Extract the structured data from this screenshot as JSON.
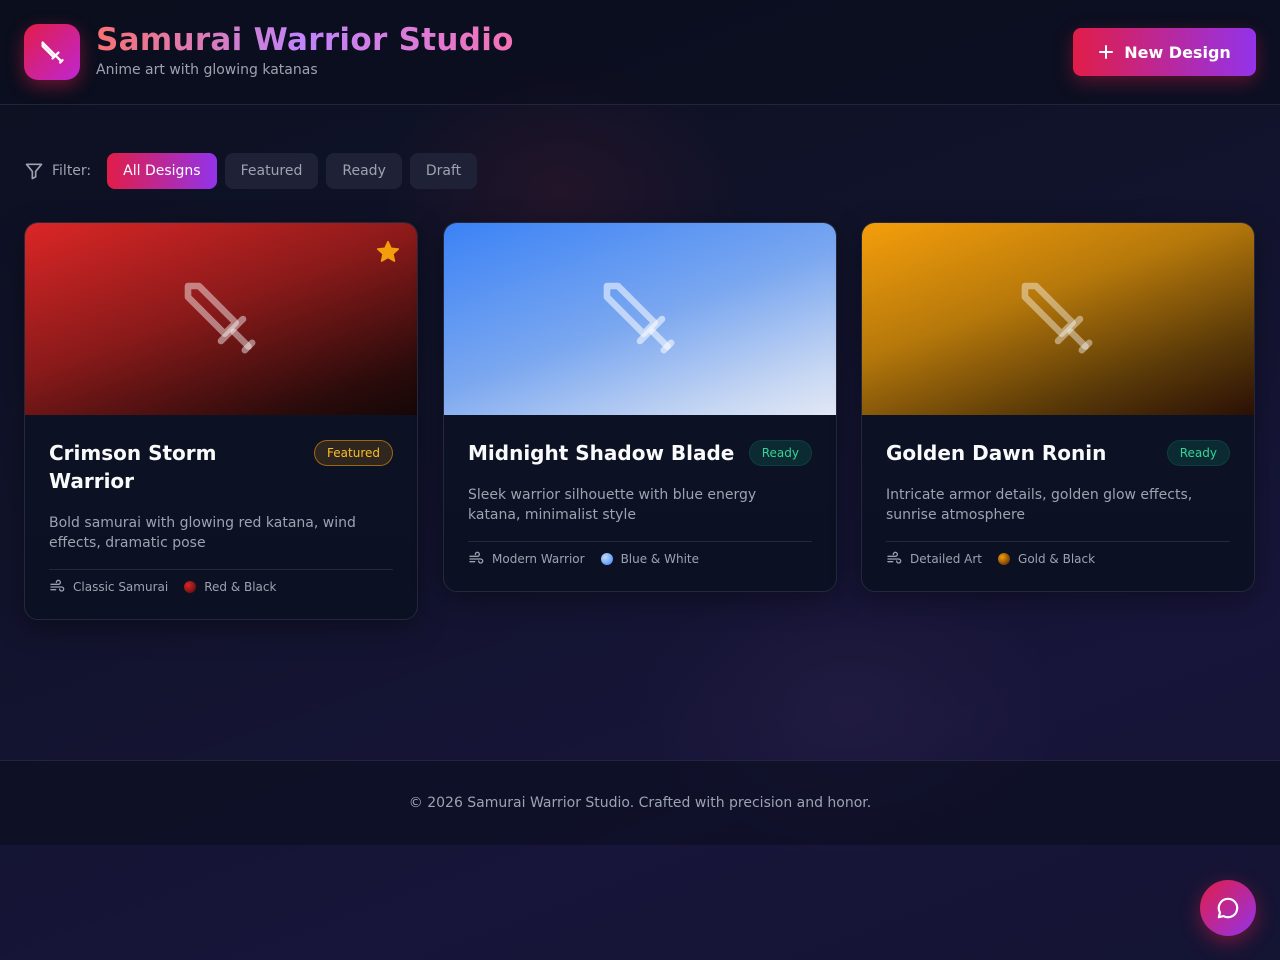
{
  "header": {
    "title": "Samurai Warrior Studio",
    "subtitle": "Anime art with glowing katanas",
    "logo_icon": "sword-icon",
    "new_design_label": "New Design"
  },
  "filters": {
    "label": "Filter:",
    "options": [
      "All Designs",
      "Featured",
      "Ready",
      "Draft"
    ],
    "selected": "All Designs"
  },
  "cards": [
    {
      "title": "Crimson Storm Warrior",
      "status": "Featured",
      "starred": true,
      "description": "Bold samurai with glowing red katana, wind effects, dramatic pose",
      "style": "Classic Samurai",
      "palette": "Red & Black",
      "accent": "#dc2626"
    },
    {
      "title": "Midnight Shadow Blade",
      "status": "Ready",
      "starred": false,
      "description": "Sleek warrior silhouette with blue energy katana, minimalist style",
      "style": "Modern Warrior",
      "palette": "Blue & White",
      "accent": "#3b82f6"
    },
    {
      "title": "Golden Dawn Ronin",
      "status": "Ready",
      "starred": false,
      "description": "Intricate armor details, golden glow effects, sunrise atmosphere",
      "style": "Detailed Art",
      "palette": "Gold & Black",
      "accent": "#f59e0b"
    }
  ],
  "footer": {
    "text": "© 2026 Samurai Warrior Studio. Crafted with precision and honor."
  },
  "colors": {
    "primary_gradient_start": "#e11d48",
    "primary_gradient_end": "#9333ea",
    "featured": "#fbbf24",
    "ready": "#34d399"
  },
  "chat_icon": "chat-bubble-icon"
}
